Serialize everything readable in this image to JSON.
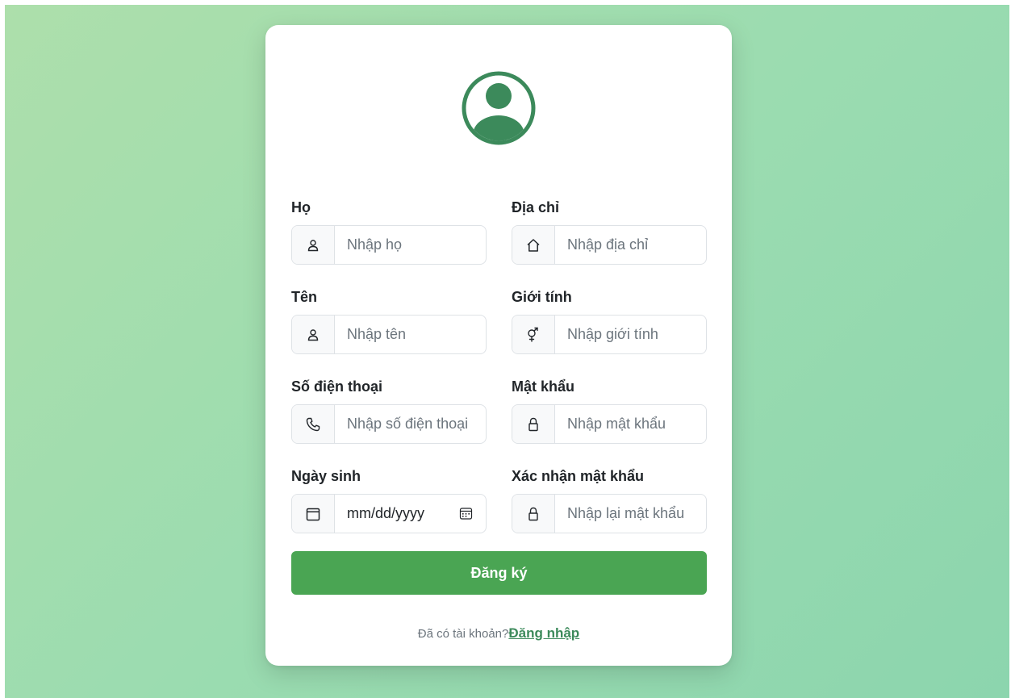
{
  "colors": {
    "accent": "#3c8a5b",
    "button": "#4aa553",
    "background_start": "#addfab",
    "background_end": "#8cd5ae"
  },
  "avatar": {
    "icon": "user-circle-icon"
  },
  "form": {
    "last_name": {
      "label": "Họ",
      "placeholder": "Nhập họ",
      "icon": "person-icon"
    },
    "first_name": {
      "label": "Tên",
      "placeholder": "Nhập tên",
      "icon": "person-icon"
    },
    "phone": {
      "label": "Số điện thoại",
      "placeholder": "Nhập số điện thoại",
      "icon": "phone-icon"
    },
    "birthday": {
      "label": "Ngày sinh",
      "value_placeholder": "mm/dd/yyyy",
      "icon": "calendar-icon",
      "picker_icon": "calendar-picker-icon"
    },
    "address": {
      "label": "Địa chỉ",
      "placeholder": "Nhập địa chỉ",
      "icon": "house-icon"
    },
    "gender": {
      "label": "Giới tính",
      "placeholder": "Nhập giới tính",
      "icon": "gender-icon"
    },
    "password": {
      "label": "Mật khẩu",
      "placeholder": "Nhập mật khẩu",
      "icon": "lock-icon"
    },
    "confirm_password": {
      "label": "Xác nhận mật khẩu",
      "placeholder": "Nhập lại mật khẩu",
      "icon": "lock-icon"
    },
    "submit_label": "Đăng ký"
  },
  "footer": {
    "prompt": "Đã có tài khoản?",
    "login_link": "Đăng nhập"
  }
}
